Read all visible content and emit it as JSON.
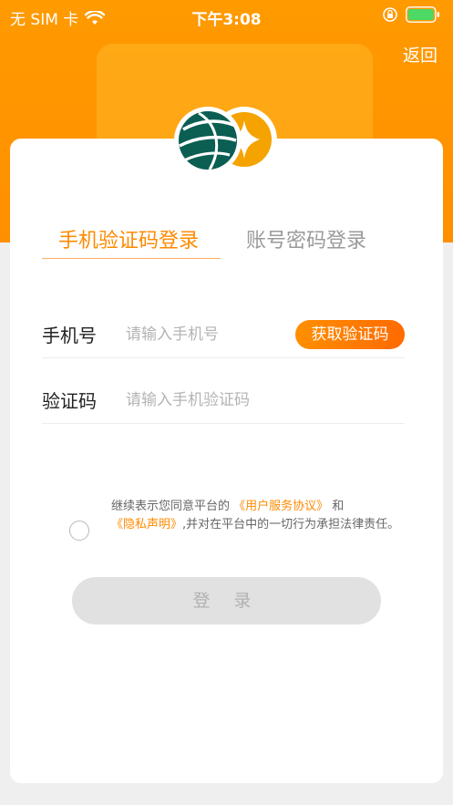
{
  "status_bar": {
    "carrier": "无 SIM 卡",
    "time": "下午3:08"
  },
  "header": {
    "back_label": "返回"
  },
  "colors": {
    "accent": "#ff8a00",
    "header_bg": "#ff9500",
    "button_gradient_end": "#ff6a00",
    "login_disabled_bg": "#e1e1e1"
  },
  "tabs": [
    {
      "label": "手机验证码登录",
      "active": true
    },
    {
      "label": "账号密码登录",
      "active": false
    }
  ],
  "form": {
    "phone_label": "手机号",
    "phone_placeholder": "请输入手机号",
    "phone_value": "",
    "get_code_label": "获取验证码",
    "code_label": "验证码",
    "code_placeholder": "请输入手机验证码",
    "code_value": ""
  },
  "agreement": {
    "prefix": "继续表示您同意平台的 ",
    "user_agreement": "《用户服务协议》",
    "and": " 和",
    "privacy": "《隐私声明》",
    "suffix": ",并对在平台中的一切行为承担法律责任。",
    "checked": false
  },
  "login_button_label": "登 录",
  "icons": {
    "wifi": "wifi-icon",
    "rotation_lock": "rotation-lock-icon",
    "battery": "battery-icon",
    "logo": "app-logo"
  }
}
